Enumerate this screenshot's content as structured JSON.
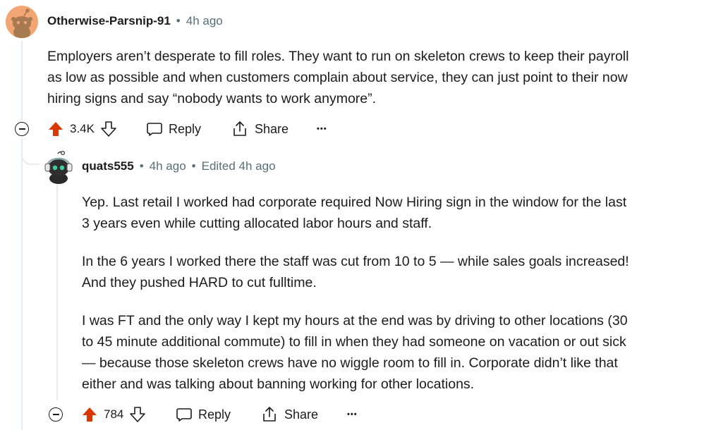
{
  "comment1": {
    "username": "Otherwise-Parsnip-91",
    "time": "4h ago",
    "lines": [
      "Employers aren’t desperate to fill roles. They want to run on skeleton crews to keep their payroll",
      "as low as possible and when customers complain about service, they can just point to their now",
      "hiring signs and say “nobody wants to work anymore”."
    ],
    "score": "3.4K",
    "reply_label": "Reply",
    "share_label": "Share",
    "more_label": "•••"
  },
  "comment2": {
    "username": "quats555",
    "time": "4h ago",
    "edited": "Edited 4h ago",
    "paragraphs": [
      [
        "Yep. Last retail I worked had corporate required Now Hiring sign in the window for the last",
        "3 years even while cutting allocated labor hours and staff."
      ],
      [
        "In the 6 years I worked there the staff was cut from 10 to 5 — while sales goals increased!",
        "And they pushed HARD to cut fulltime."
      ],
      [
        "I was FT and the only way I kept my hours at the end was by driving to other locations (30",
        "to 45 minute additional commute) to fill in when they had someone on vacation or out sick",
        "— because those skeleton crews have no wiggle room to fill in. Corporate didn’t like that",
        "either and was talking about banning working for other locations."
      ]
    ],
    "score": "784",
    "reply_label": "Reply",
    "share_label": "Share",
    "more_label": "•••"
  },
  "colors": {
    "upvote_active": "#d93900",
    "meta_text": "#576f76",
    "thread_line": "#e5ebee",
    "avatar1_bg": "#f4a574"
  },
  "icons": [
    "upvote-icon",
    "downvote-icon",
    "comment-icon",
    "share-icon",
    "collapse-icon",
    "more-icon"
  ]
}
